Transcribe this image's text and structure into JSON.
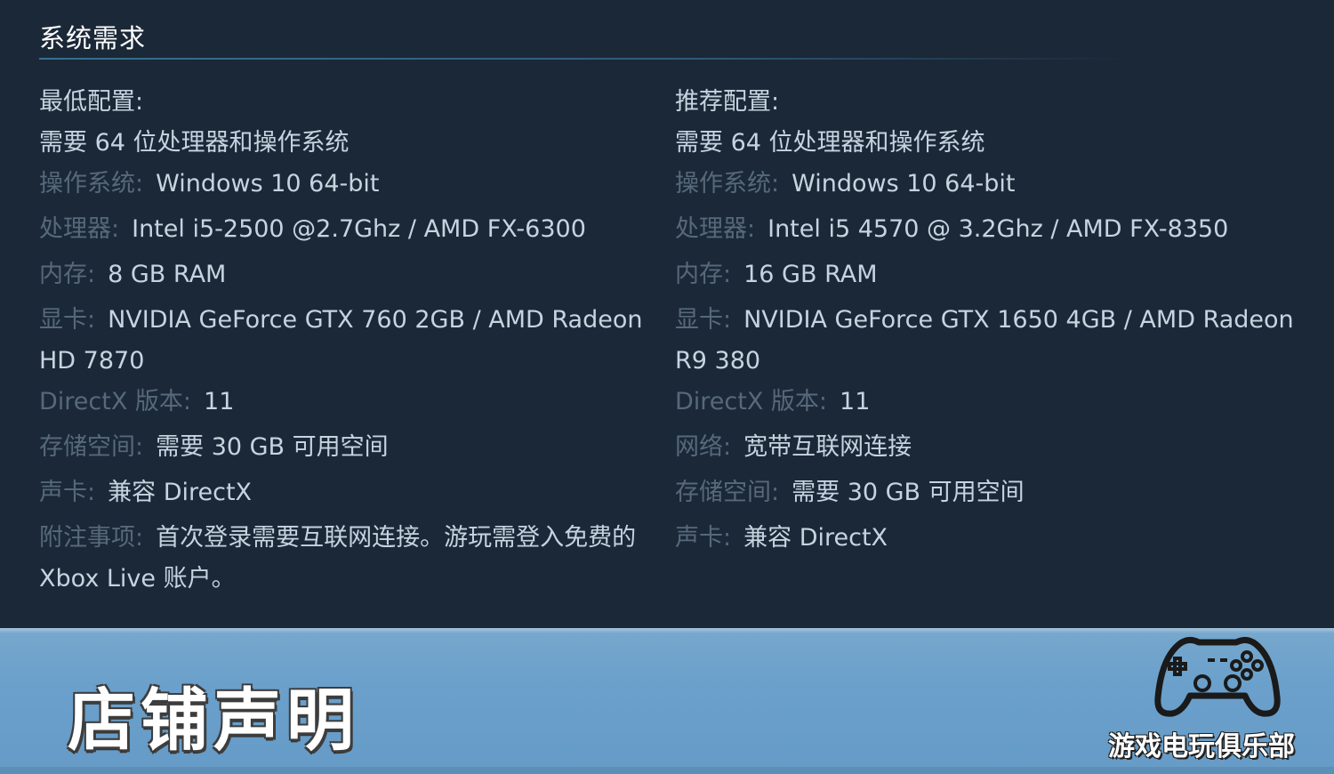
{
  "section": {
    "title": "系统需求"
  },
  "minimum": {
    "heading": "最低配置:",
    "note_64bit": "需要 64 位处理器和操作系统",
    "rows": [
      {
        "label": "操作系统:",
        "value": "Windows 10 64-bit"
      },
      {
        "label": "处理器:",
        "value": "Intel i5-2500 @2.7Ghz / AMD FX-6300"
      },
      {
        "label": "内存:",
        "value": "8 GB RAM"
      },
      {
        "label": "显卡:",
        "value": "NVIDIA GeForce GTX 760 2GB / AMD Radeon",
        "value_cont": "HD 7870"
      },
      {
        "label": "DirectX 版本:",
        "value": "11"
      },
      {
        "label": "存储空间:",
        "value": "需要 30 GB 可用空间"
      },
      {
        "label": "声卡:",
        "value": "兼容 DirectX"
      },
      {
        "label": "附注事项:",
        "value": "首次登录需要互联网连接。游玩需登入免费的",
        "value_cont": "Xbox Live 账户。"
      }
    ]
  },
  "recommended": {
    "heading": "推荐配置:",
    "note_64bit": "需要 64 位处理器和操作系统",
    "rows": [
      {
        "label": "操作系统:",
        "value": "Windows 10 64-bit"
      },
      {
        "label": "处理器:",
        "value": "Intel i5 4570 @ 3.2Ghz / AMD FX-8350"
      },
      {
        "label": "内存:",
        "value": "16 GB RAM"
      },
      {
        "label": "显卡:",
        "value": "NVIDIA GeForce GTX 1650 4GB / AMD Radeon",
        "value_cont": "R9 380"
      },
      {
        "label": "DirectX 版本:",
        "value": "11"
      },
      {
        "label": "网络:",
        "value": "宽带互联网连接"
      },
      {
        "label": "存储空间:",
        "value": "需要 30 GB 可用空间"
      },
      {
        "label": "声卡:",
        "value": "兼容 DirectX"
      }
    ]
  },
  "banner": {
    "title": "店铺声明",
    "club_name": "游戏电玩俱乐部",
    "icon": "gamepad-icon"
  },
  "colors": {
    "background": "#1b2838",
    "text": "#c6d4df",
    "label": "#56697a",
    "banner": "#6aa0cb"
  }
}
